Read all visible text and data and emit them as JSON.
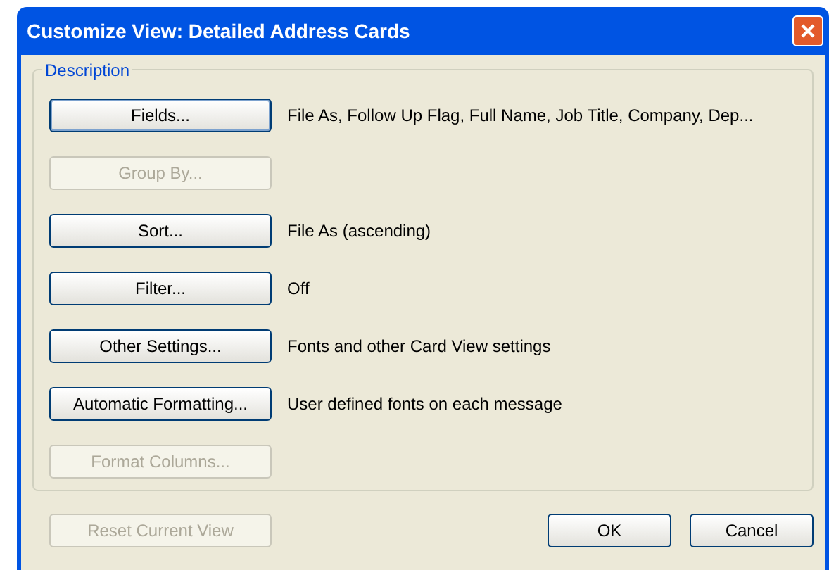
{
  "window": {
    "title": "Customize View: Detailed Address Cards"
  },
  "group": {
    "title": "Description"
  },
  "rows": [
    {
      "button": "Fields...",
      "description": "File As, Follow Up Flag, Full Name, Job Title, Company, Dep...",
      "disabled": false,
      "selected": true
    },
    {
      "button": "Group By...",
      "disabled": true,
      "selected": false
    },
    {
      "button": "Sort...",
      "description": "File As (ascending)",
      "disabled": false,
      "selected": false
    },
    {
      "button": "Filter...",
      "description": "Off",
      "disabled": false,
      "selected": false
    },
    {
      "button": "Other Settings...",
      "description": "Fonts and other Card View settings",
      "disabled": false,
      "selected": false
    },
    {
      "button": "Automatic Formatting...",
      "description": "User defined fonts on each message",
      "disabled": false,
      "selected": false
    },
    {
      "button": "Format Columns...",
      "disabled": true,
      "selected": false
    }
  ],
  "footer": {
    "reset": {
      "label": "Reset Current View",
      "disabled": true
    },
    "ok": "OK",
    "cancel": "Cancel"
  }
}
